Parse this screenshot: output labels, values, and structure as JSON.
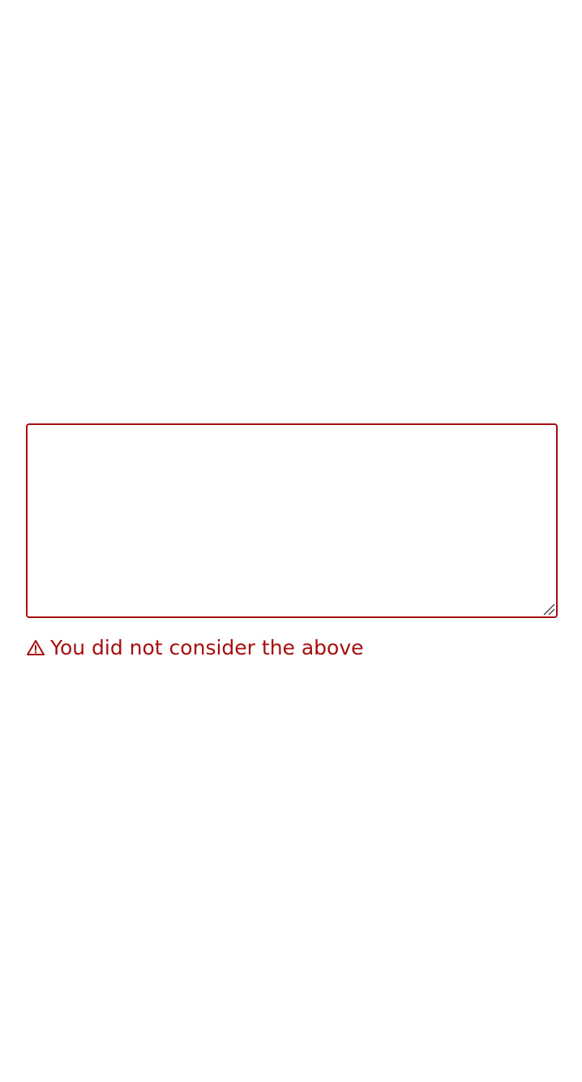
{
  "form": {
    "textarea": {
      "value": "",
      "placeholder": ""
    },
    "error": {
      "icon": "warning-icon",
      "message": "You did not consider the above"
    }
  },
  "colors": {
    "error": "#a50e0e",
    "background": "#ffffff"
  }
}
